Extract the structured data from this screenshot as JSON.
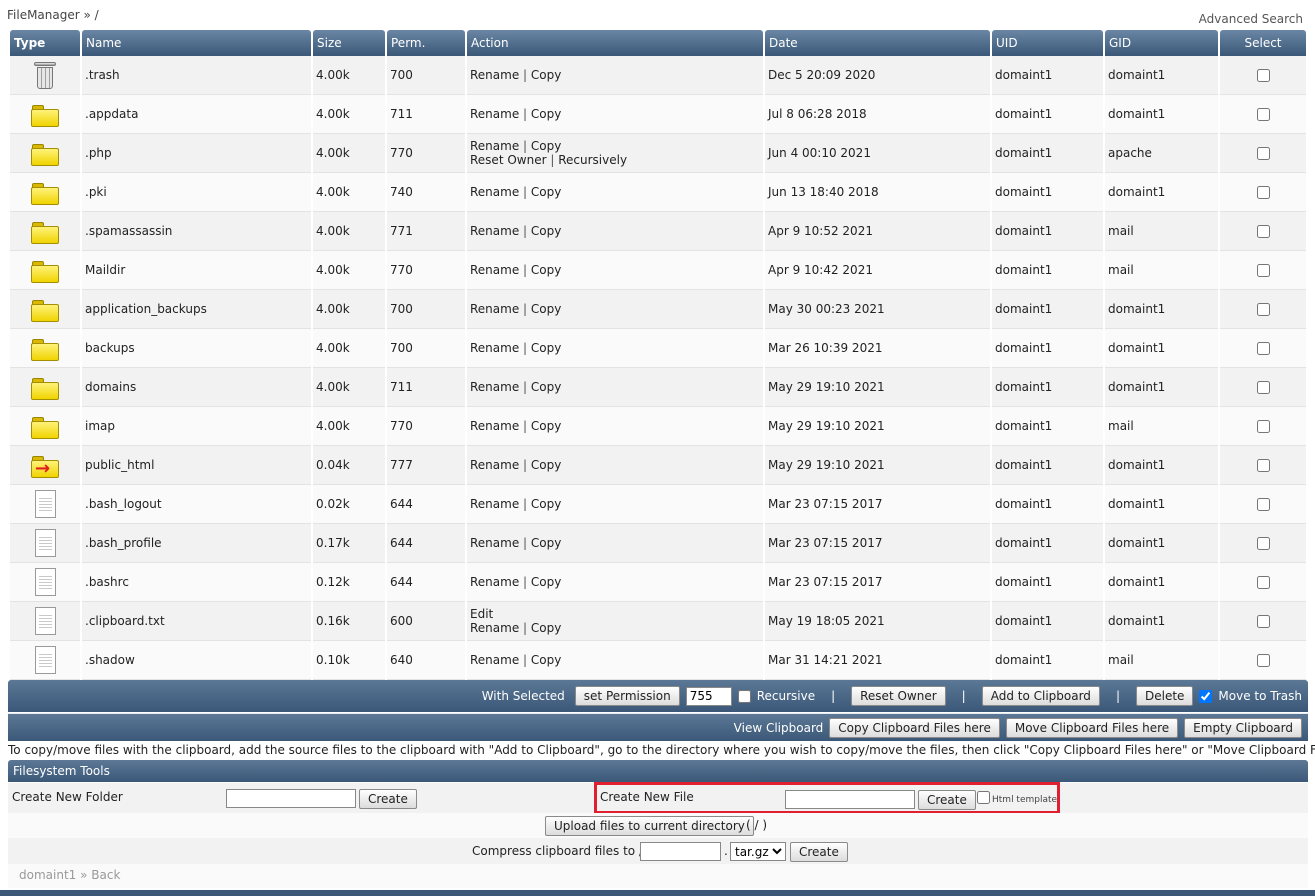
{
  "header": {
    "breadcrumb": "FileManager » /",
    "advanced_search": "Advanced Search"
  },
  "columns": {
    "type": "Type",
    "name": "Name",
    "size": "Size",
    "perm": "Perm.",
    "action": "Action",
    "date": "Date",
    "uid": "UID",
    "gid": "GID",
    "select": "Select"
  },
  "actions": {
    "rename": "Rename",
    "copy": "Copy",
    "sep": "|",
    "reset_owner": "Reset Owner",
    "recursively": "Recursively",
    "edit": "Edit"
  },
  "rows": [
    {
      "icon": "trash-icon",
      "name": ".trash",
      "size": "4.00k",
      "perm": "700",
      "date": "Dec 5 20:09 2020",
      "uid": "domaint1",
      "gid": "domaint1",
      "variant": "standard"
    },
    {
      "icon": "folder-icon",
      "name": ".appdata",
      "size": "4.00k",
      "perm": "711",
      "date": "Jul 8 06:28 2018",
      "uid": "domaint1",
      "gid": "domaint1",
      "variant": "standard"
    },
    {
      "icon": "folder-icon",
      "name": ".php",
      "size": "4.00k",
      "perm": "770",
      "date": "Jun 4 00:10 2021",
      "uid": "domaint1",
      "gid": "apache",
      "variant": "owner"
    },
    {
      "icon": "folder-icon",
      "name": ".pki",
      "size": "4.00k",
      "perm": "740",
      "date": "Jun 13 18:40 2018",
      "uid": "domaint1",
      "gid": "domaint1",
      "variant": "standard"
    },
    {
      "icon": "folder-icon",
      "name": ".spamassassin",
      "size": "4.00k",
      "perm": "771",
      "date": "Apr 9 10:52 2021",
      "uid": "domaint1",
      "gid": "mail",
      "variant": "standard"
    },
    {
      "icon": "folder-icon",
      "name": "Maildir",
      "size": "4.00k",
      "perm": "770",
      "date": "Apr 9 10:42 2021",
      "uid": "domaint1",
      "gid": "mail",
      "variant": "standard"
    },
    {
      "icon": "folder-icon",
      "name": "application_backups",
      "size": "4.00k",
      "perm": "700",
      "date": "May 30 00:23 2021",
      "uid": "domaint1",
      "gid": "domaint1",
      "variant": "standard"
    },
    {
      "icon": "folder-icon",
      "name": "backups",
      "size": "4.00k",
      "perm": "700",
      "date": "Mar 26 10:39 2021",
      "uid": "domaint1",
      "gid": "domaint1",
      "variant": "standard"
    },
    {
      "icon": "folder-icon",
      "name": "domains",
      "size": "4.00k",
      "perm": "711",
      "date": "May 29 19:10 2021",
      "uid": "domaint1",
      "gid": "domaint1",
      "variant": "standard"
    },
    {
      "icon": "folder-icon",
      "name": "imap",
      "size": "4.00k",
      "perm": "770",
      "date": "May 29 19:10 2021",
      "uid": "domaint1",
      "gid": "mail",
      "variant": "standard"
    },
    {
      "icon": "folder-link-icon",
      "name": "public_html",
      "size": "0.04k",
      "perm": "777",
      "date": "May 29 19:10 2021",
      "uid": "domaint1",
      "gid": "domaint1",
      "variant": "standard"
    },
    {
      "icon": "file-icon",
      "name": ".bash_logout",
      "size": "0.02k",
      "perm": "644",
      "date": "Mar 23 07:15 2017",
      "uid": "domaint1",
      "gid": "domaint1",
      "variant": "standard"
    },
    {
      "icon": "file-icon",
      "name": ".bash_profile",
      "size": "0.17k",
      "perm": "644",
      "date": "Mar 23 07:15 2017",
      "uid": "domaint1",
      "gid": "domaint1",
      "variant": "standard"
    },
    {
      "icon": "file-icon",
      "name": ".bashrc",
      "size": "0.12k",
      "perm": "644",
      "date": "Mar 23 07:15 2017",
      "uid": "domaint1",
      "gid": "domaint1",
      "variant": "standard"
    },
    {
      "icon": "file-icon",
      "name": ".clipboard.txt",
      "size": "0.16k",
      "perm": "600",
      "date": "May 19 18:05 2021",
      "uid": "domaint1",
      "gid": "domaint1",
      "variant": "edit"
    },
    {
      "icon": "file-icon",
      "name": ".shadow",
      "size": "0.10k",
      "perm": "640",
      "date": "Mar 31 14:21 2021",
      "uid": "domaint1",
      "gid": "mail",
      "variant": "standard"
    }
  ],
  "selected_bar": {
    "with_selected": "With Selected",
    "set_permission": "set Permission",
    "permission_value": "755",
    "recursive": "Recursive",
    "reset_owner": "Reset Owner",
    "add_to_clipboard": "Add to Clipboard",
    "delete": "Delete",
    "move_to_trash": "Move to Trash",
    "move_to_trash_checked": true,
    "sep": "|"
  },
  "clipboard_bar": {
    "view_clipboard": "View Clipboard",
    "copy_here": "Copy Clipboard Files here",
    "move_here": "Move Clipboard Files here",
    "empty": "Empty Clipboard"
  },
  "clipboard_note": "To copy/move files with the clipboard, add the source files to the clipboard with \"Add to Clipboard\", go to the directory where you wish to copy/move the files, then click \"Copy Clipboard Files here\" or \"Move Clipboard Files here\"",
  "tools": {
    "title": "Filesystem Tools",
    "create_folder_label": "Create New Folder",
    "create_folder_value": "",
    "create_file_label": "Create New File",
    "create_file_value": "",
    "create": "Create",
    "html_template": "Html template",
    "upload": "Upload files to current directory",
    "upload_path": "( / )",
    "compress_label": "Compress clipboard files to //",
    "compress_value": "",
    "compress_dot": ".",
    "compress_format": "tar.gz"
  },
  "footer": {
    "user": "domaint1",
    "sep": "»",
    "back": "Back"
  }
}
